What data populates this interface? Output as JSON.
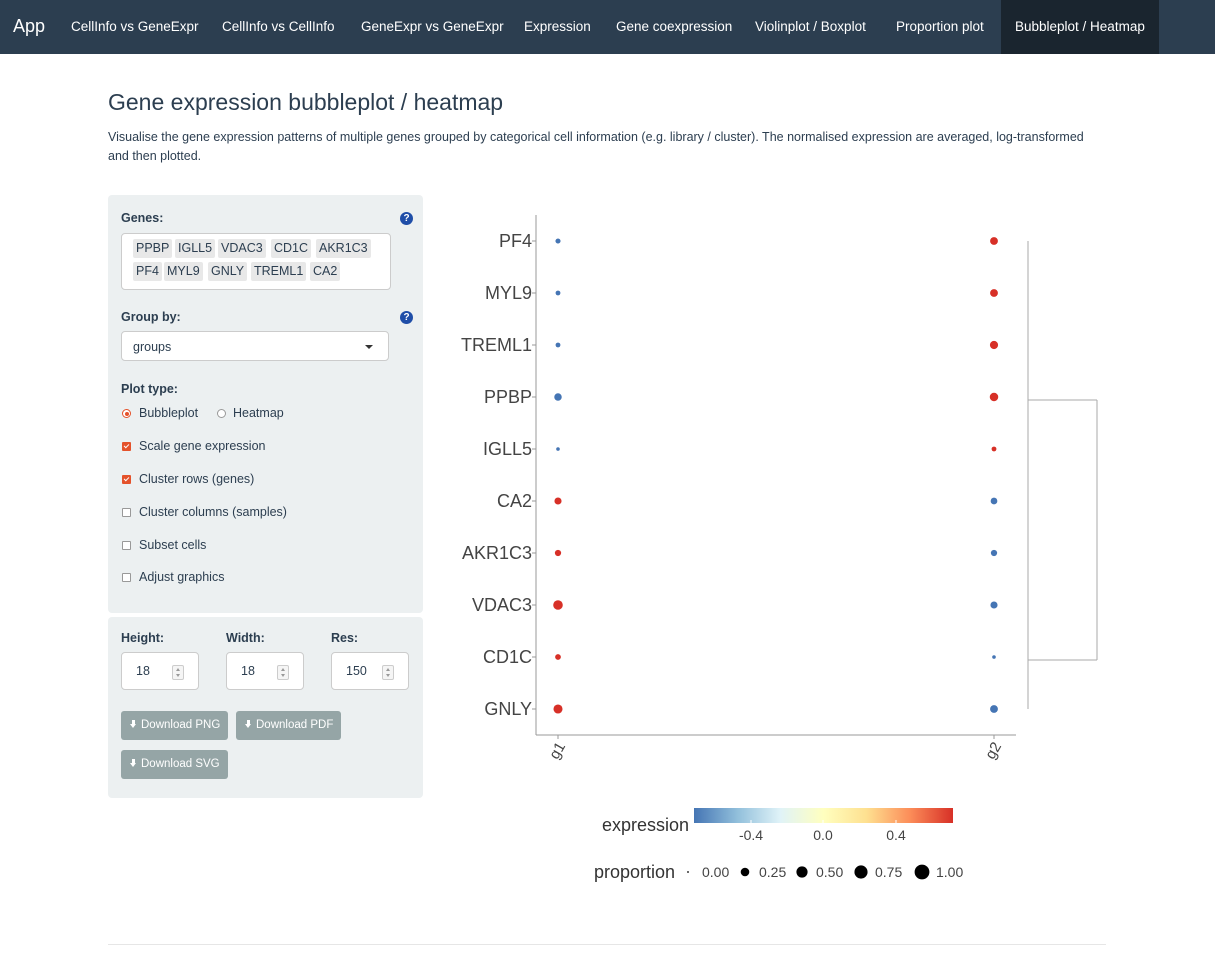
{
  "nav": {
    "brand": "App",
    "items": [
      {
        "label": "CellInfo vs GeneExpr"
      },
      {
        "label": "CellInfo vs CellInfo"
      },
      {
        "label": "GeneExpr vs GeneExpr"
      },
      {
        "label": "Expression"
      },
      {
        "label": "Gene coexpression"
      },
      {
        "label": "Violinplot / Boxplot"
      },
      {
        "label": "Proportion plot"
      },
      {
        "label": "Bubbleplot / Heatmap",
        "active": true
      }
    ]
  },
  "page": {
    "title": "Gene expression bubbleplot / heatmap",
    "description": "Visualise the gene expression patterns of multiple genes grouped by categorical cell information (e.g. library / cluster). The normalised expression are averaged, log-transformed and then plotted."
  },
  "controls": {
    "genes_label": "Genes:",
    "genes": [
      "PPBP",
      "IGLL5",
      "VDAC3",
      "CD1C",
      "AKR1C3",
      "PF4",
      "MYL9",
      "GNLY",
      "TREML1",
      "CA2"
    ],
    "group_by_label": "Group by:",
    "group_by_value": "groups",
    "plot_type_label": "Plot type:",
    "plot_types": [
      {
        "label": "Bubbleplot",
        "selected": true
      },
      {
        "label": "Heatmap",
        "selected": false
      }
    ],
    "checkboxes": [
      {
        "label": "Scale gene expression",
        "checked": true
      },
      {
        "label": "Cluster rows (genes)",
        "checked": true
      },
      {
        "label": "Cluster columns (samples)",
        "checked": false
      },
      {
        "label": "Subset cells",
        "checked": false
      },
      {
        "label": "Adjust graphics",
        "checked": false
      }
    ],
    "help_icon": "?"
  },
  "download": {
    "height_label": "Height:",
    "height_value": "18",
    "width_label": "Width:",
    "width_value": "18",
    "res_label": "Res:",
    "res_value": "150",
    "btn_png": "Download PNG",
    "btn_pdf": "Download PDF",
    "btn_svg": "Download SVG"
  },
  "chart_data": {
    "type": "scatter",
    "categories_x": [
      "g1",
      "g2"
    ],
    "categories_y": [
      "PF4",
      "MYL9",
      "TREML1",
      "PPBP",
      "IGLL5",
      "CA2",
      "AKR1C3",
      "VDAC3",
      "CD1C",
      "GNLY"
    ],
    "points": [
      {
        "gene": "PF4",
        "g1": {
          "expression": -0.6,
          "proportion": 0.1
        },
        "g2": {
          "expression": 0.6,
          "proportion": 0.4
        }
      },
      {
        "gene": "MYL9",
        "g1": {
          "expression": -0.6,
          "proportion": 0.08
        },
        "g2": {
          "expression": 0.6,
          "proportion": 0.4
        }
      },
      {
        "gene": "TREML1",
        "g1": {
          "expression": -0.6,
          "proportion": 0.08
        },
        "g2": {
          "expression": 0.6,
          "proportion": 0.45
        }
      },
      {
        "gene": "PPBP",
        "g1": {
          "expression": -0.6,
          "proportion": 0.35
        },
        "g2": {
          "expression": 0.6,
          "proportion": 0.5
        }
      },
      {
        "gene": "IGLL5",
        "g1": {
          "expression": -0.6,
          "proportion": 0.02
        },
        "g2": {
          "expression": 0.6,
          "proportion": 0.08
        }
      },
      {
        "gene": "CA2",
        "g1": {
          "expression": 0.6,
          "proportion": 0.3
        },
        "g2": {
          "expression": -0.6,
          "proportion": 0.25
        }
      },
      {
        "gene": "AKR1C3",
        "g1": {
          "expression": 0.6,
          "proportion": 0.2
        },
        "g2": {
          "expression": -0.6,
          "proportion": 0.2
        }
      },
      {
        "gene": "VDAC3",
        "g1": {
          "expression": 0.6,
          "proportion": 0.7
        },
        "g2": {
          "expression": -0.6,
          "proportion": 0.3
        }
      },
      {
        "gene": "CD1C",
        "g1": {
          "expression": 0.6,
          "proportion": 0.15
        },
        "g2": {
          "expression": -0.6,
          "proportion": 0.02
        }
      },
      {
        "gene": "GNLY",
        "g1": {
          "expression": 0.6,
          "proportion": 0.6
        },
        "g2": {
          "expression": -0.6,
          "proportion": 0.4
        }
      }
    ],
    "legend": {
      "expression_title": "expression",
      "expression_ticks": [
        "-0.4",
        "0.0",
        "0.4"
      ],
      "expression_colors": [
        "#4575b4",
        "#91bfdb",
        "#e0f3f8",
        "#ffffbf",
        "#fee090",
        "#fc8d59",
        "#d73027"
      ],
      "proportion_title": "proportion",
      "proportion_ticks": [
        "0.00",
        "0.25",
        "0.50",
        "0.75",
        "1.00"
      ],
      "proportion_values": [
        0,
        0.25,
        0.5,
        0.75,
        1.0
      ]
    },
    "colors": {
      "low": "#4575b4",
      "high": "#d73027"
    }
  }
}
